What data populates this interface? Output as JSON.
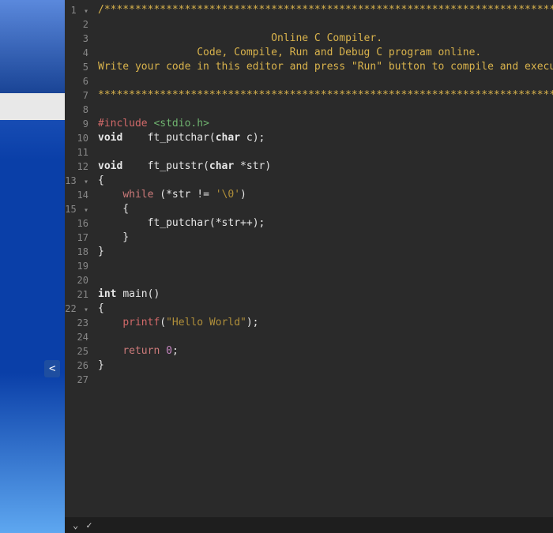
{
  "sidebar": {
    "collapse_glyph": "<"
  },
  "editor": {
    "line_numbers": [
      "1",
      "2",
      "3",
      "4",
      "5",
      "6",
      "7",
      "8",
      "9",
      "10",
      "11",
      "12",
      "13",
      "14",
      "15",
      "16",
      "17",
      "18",
      "19",
      "20",
      "21",
      "22",
      "23",
      "24",
      "25",
      "26",
      "27"
    ],
    "fold_lines": [
      1,
      13,
      15,
      22
    ],
    "lines": [
      {
        "n": 1,
        "tokens": [
          {
            "cls": "c-comment-star",
            "t": "/******************************************************************************"
          }
        ]
      },
      {
        "n": 2,
        "tokens": []
      },
      {
        "n": 3,
        "tokens": [
          {
            "cls": "c-comment-text",
            "t": "                            Online C Compiler."
          }
        ]
      },
      {
        "n": 4,
        "tokens": [
          {
            "cls": "c-comment-text",
            "t": "                Code, Compile, Run and Debug C program online."
          }
        ]
      },
      {
        "n": 5,
        "tokens": [
          {
            "cls": "c-comment-text",
            "t": "Write your code in this editor and press \"Run\" button to compile and execute it."
          }
        ]
      },
      {
        "n": 6,
        "tokens": []
      },
      {
        "n": 7,
        "tokens": [
          {
            "cls": "c-comment-star",
            "t": "*******************************************************************************/"
          }
        ]
      },
      {
        "n": 8,
        "tokens": []
      },
      {
        "n": 9,
        "tokens": [
          {
            "cls": "c-pre",
            "t": "#include "
          },
          {
            "cls": "c-inc",
            "t": "<stdio.h>"
          }
        ]
      },
      {
        "n": 10,
        "tokens": [
          {
            "cls": "c-type",
            "t": "void"
          },
          {
            "cls": "c-punc",
            "t": "    "
          },
          {
            "cls": "c-fn2",
            "t": "ft_putchar"
          },
          {
            "cls": "c-punc",
            "t": "("
          },
          {
            "cls": "c-type",
            "t": "char"
          },
          {
            "cls": "c-punc",
            "t": " c);"
          }
        ]
      },
      {
        "n": 11,
        "tokens": []
      },
      {
        "n": 12,
        "tokens": [
          {
            "cls": "c-type",
            "t": "void"
          },
          {
            "cls": "c-punc",
            "t": "    "
          },
          {
            "cls": "c-fn2",
            "t": "ft_putstr"
          },
          {
            "cls": "c-punc",
            "t": "("
          },
          {
            "cls": "c-type",
            "t": "char"
          },
          {
            "cls": "c-punc",
            "t": " *str)"
          }
        ]
      },
      {
        "n": 13,
        "tokens": [
          {
            "cls": "c-punc",
            "t": "{"
          }
        ]
      },
      {
        "n": 14,
        "tokens": [
          {
            "cls": "c-punc",
            "t": "    "
          },
          {
            "cls": "c-kw",
            "t": "while"
          },
          {
            "cls": "c-punc",
            "t": " (*str != "
          },
          {
            "cls": "c-str",
            "t": "'\\0'"
          },
          {
            "cls": "c-punc",
            "t": ")"
          }
        ]
      },
      {
        "n": 15,
        "tokens": [
          {
            "cls": "c-punc",
            "t": "    {"
          }
        ]
      },
      {
        "n": 16,
        "tokens": [
          {
            "cls": "c-punc",
            "t": "        "
          },
          {
            "cls": "c-fn2",
            "t": "ft_putchar"
          },
          {
            "cls": "c-punc",
            "t": "(*str++);"
          }
        ]
      },
      {
        "n": 17,
        "tokens": [
          {
            "cls": "c-punc",
            "t": "    }"
          }
        ]
      },
      {
        "n": 18,
        "tokens": [
          {
            "cls": "c-punc",
            "t": "}"
          }
        ]
      },
      {
        "n": 19,
        "tokens": []
      },
      {
        "n": 20,
        "tokens": []
      },
      {
        "n": 21,
        "tokens": [
          {
            "cls": "c-type",
            "t": "int"
          },
          {
            "cls": "c-punc",
            "t": " "
          },
          {
            "cls": "c-fn2",
            "t": "main"
          },
          {
            "cls": "c-punc",
            "t": "()"
          }
        ]
      },
      {
        "n": 22,
        "tokens": [
          {
            "cls": "c-punc",
            "t": "{"
          }
        ]
      },
      {
        "n": 23,
        "tokens": [
          {
            "cls": "c-punc",
            "t": "    "
          },
          {
            "cls": "c-printf",
            "t": "printf"
          },
          {
            "cls": "c-punc",
            "t": "("
          },
          {
            "cls": "c-str",
            "t": "\"Hello World\""
          },
          {
            "cls": "c-punc",
            "t": ");"
          }
        ]
      },
      {
        "n": 24,
        "tokens": []
      },
      {
        "n": 25,
        "tokens": [
          {
            "cls": "c-punc",
            "t": "    "
          },
          {
            "cls": "c-kw",
            "t": "return"
          },
          {
            "cls": "c-punc",
            "t": " "
          },
          {
            "cls": "c-num",
            "t": "0"
          },
          {
            "cls": "c-punc",
            "t": ";"
          }
        ]
      },
      {
        "n": 26,
        "tokens": [
          {
            "cls": "c-punc",
            "t": "}"
          }
        ]
      },
      {
        "n": 27,
        "tokens": []
      }
    ]
  },
  "statusbar": {
    "left1": "⌄",
    "left2": "✓"
  }
}
